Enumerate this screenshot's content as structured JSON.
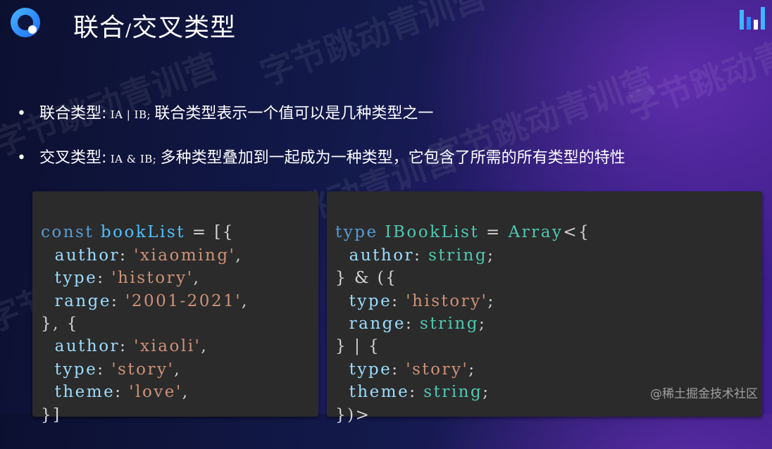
{
  "slide": {
    "title_part1": "联合",
    "title_sep": "/",
    "title_part2": "交叉类型",
    "watermark": "字节跳动青训营"
  },
  "bullets": [
    {
      "bullet_char": "•",
      "label": "联合类型:",
      "code": " IA | IB; ",
      "desc": "联合类型表示一个值可以是几种类型之一"
    },
    {
      "bullet_char": "•",
      "label": "交叉类型:",
      "code": " IA & IB; ",
      "desc": "多种类型叠加到一起成为一种类型，它包含了所需的所有类型的特性"
    }
  ],
  "code_left": {
    "l1": {
      "kw": "const",
      "id": "bookList",
      "rest": " = [{"
    },
    "l2": {
      "prop": "author",
      "colon": ": ",
      "str": "'xiaoming'",
      "tail": ","
    },
    "l3": {
      "prop": "type",
      "colon": ": ",
      "str": "'history'",
      "tail": ","
    },
    "l4": {
      "prop": "range",
      "colon": ": ",
      "str": "'2001-2021'",
      "tail": ","
    },
    "l5": {
      "text": "}, {"
    },
    "l6": {
      "prop": "author",
      "colon": ": ",
      "str": "'xiaoli'",
      "tail": ","
    },
    "l7": {
      "prop": "type",
      "colon": ": ",
      "str": "'story'",
      "tail": ","
    },
    "l8": {
      "prop": "theme",
      "colon": ": ",
      "str": "'love'",
      "tail": ","
    },
    "l9": {
      "text": "}]"
    }
  },
  "code_right": {
    "l1": {
      "kw": "type",
      "typ": "IBookList",
      "eq": " = ",
      "typ2": "Array",
      "rest": "<{"
    },
    "l2": {
      "prop": "author",
      "colon": ": ",
      "typ": "string",
      "tail": ";"
    },
    "l3": {
      "text": "} & ({"
    },
    "l4": {
      "prop": "type",
      "colon": ": ",
      "str": "'history'",
      "tail": ";"
    },
    "l5": {
      "prop": "range",
      "colon": ": ",
      "typ": "string",
      "tail": ";"
    },
    "l6": {
      "text": "} | {"
    },
    "l7": {
      "prop": "type",
      "colon": ": ",
      "str": "'story'",
      "tail": ";"
    },
    "l8": {
      "prop": "theme",
      "colon": ": ",
      "typ": "string",
      "tail": ";"
    },
    "l9": {
      "text": "})>"
    }
  },
  "footer": {
    "text": "@稀土掘金技术社区"
  },
  "colors": {
    "keyword": "#569cd6",
    "identifier": "#4fc1ff",
    "type": "#4ec9b0",
    "property": "#9cdcfe",
    "string": "#ce9178",
    "code_bg": "#2b2b2b"
  },
  "icons": {
    "logo": "qingxunying-logo-icon",
    "brand": "bar-chart-brand-icon"
  }
}
